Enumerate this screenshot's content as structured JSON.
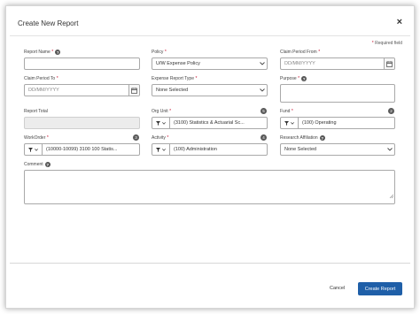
{
  "dialog": {
    "title": "Create New Report",
    "close_glyph": "×",
    "required_asterisk": "*",
    "required_note": "Required field"
  },
  "fields": {
    "report_name": {
      "label": "Report Name",
      "value": ""
    },
    "policy": {
      "label": "Policy",
      "value": "U/W Expense Policy"
    },
    "claim_period_from": {
      "label": "Claim Period From",
      "placeholder": "DD/MM/YYYY"
    },
    "claim_period_to": {
      "label": "Claim Period To",
      "placeholder": "DD/MM/YYYY"
    },
    "expense_report_type": {
      "label": "Expense Report Type",
      "value": "None Selected"
    },
    "purpose": {
      "label": "Purpose",
      "value": ""
    },
    "report_total": {
      "label": "Report Total",
      "value": ""
    },
    "org_unit": {
      "label": "Org Unit",
      "value": "(3100) Statistics & Actuarial Sc...",
      "badge": "5"
    },
    "fund": {
      "label": "Fund",
      "value": "(100) Operating",
      "badge": "2"
    },
    "workorder": {
      "label": "WorkOrder",
      "value": "(10000-10099) 3100 100 Statis...",
      "badge": "3"
    },
    "activity": {
      "label": "Activity",
      "value": "(100) Administration",
      "badge": "4"
    },
    "research_affiliation": {
      "label": "Research Affiliation",
      "value": "None Selected"
    },
    "comment": {
      "label": "Comment",
      "value": ""
    }
  },
  "footer": {
    "cancel_label": "Cancel",
    "create_label": "Create Report"
  },
  "icons": {
    "help": "?",
    "chevron": "chevron-down-icon",
    "calendar": "calendar-icon",
    "filter": "filter-icon"
  },
  "colors": {
    "primary_button": "#1f5fa8",
    "required": "#c8102e",
    "badge": "#5a5a5a"
  }
}
